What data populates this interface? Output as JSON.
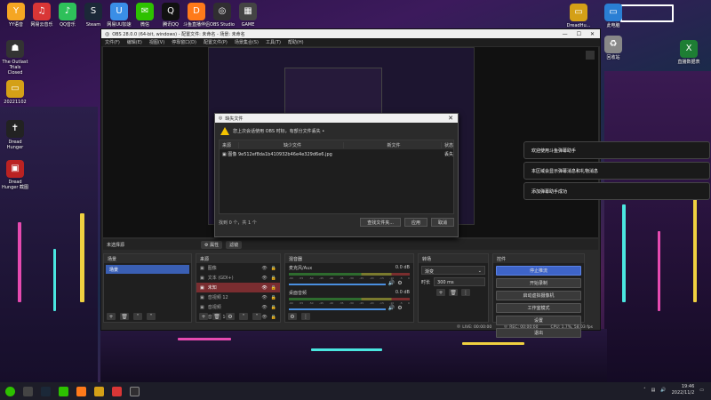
{
  "desktop": {
    "icons_top": [
      {
        "label": "YY语音",
        "color": "#f5a623",
        "glyph": "Y"
      },
      {
        "label": "网易云音乐",
        "color": "#d93636",
        "glyph": "♫"
      },
      {
        "label": "QQ音乐",
        "color": "#2ec05a",
        "glyph": "♪"
      },
      {
        "label": "Steam",
        "color": "#1b2838",
        "glyph": "S"
      },
      {
        "label": "网易UU加速",
        "color": "#3a8ee6",
        "glyph": "U"
      },
      {
        "label": "微信",
        "color": "#2dc100",
        "glyph": "✉"
      },
      {
        "label": "腾讯QQ",
        "color": "#111",
        "glyph": "Q"
      },
      {
        "label": "斗鱼直播伴侣",
        "color": "#ff7a1a",
        "glyph": "D"
      },
      {
        "label": "OBS Studio",
        "color": "#302e31",
        "glyph": "◎"
      },
      {
        "label": "GAME",
        "color": "#444",
        "glyph": "▦"
      }
    ],
    "icons_left": [
      {
        "label": "The Outlast Trials Closed",
        "color": "#333",
        "glyph": "☗"
      },
      {
        "label": "20221102",
        "color": "#d4a017",
        "glyph": "▭"
      },
      {
        "label": "Dread Hunger",
        "color": "#222",
        "glyph": "✝"
      },
      {
        "label": "Dread Hunger 截图",
        "color": "#b22",
        "glyph": "▣"
      }
    ],
    "icons_right": [
      {
        "label": "DreadHu...",
        "color": "#d4a017",
        "glyph": "▭"
      },
      {
        "label": "此电脑",
        "color": "#2a7fd4",
        "glyph": "▭"
      },
      {
        "label": "回收站",
        "color": "#888",
        "glyph": "♻"
      },
      {
        "label": "直播数据表",
        "color": "#1e7e34",
        "glyph": "X"
      }
    ]
  },
  "obs": {
    "title": "OBS 28.0.0 (64-bit, windows) - 配置文件: 未命名 - 场景: 未命名",
    "menu": [
      "文件(F)",
      "编辑(E)",
      "视图(V)",
      "停靠窗口(D)",
      "配置文件(P)",
      "场景集合(S)",
      "工具(T)",
      "帮助(H)"
    ],
    "no_source": "未选择源",
    "properties_label": "属性",
    "filters_label": "滤镜",
    "scenes": {
      "header": "场景",
      "items": [
        "场景"
      ]
    },
    "sources": {
      "header": "来源",
      "items": [
        {
          "label": "图像",
          "selected": false
        },
        {
          "label": "文本 (GDI+)",
          "selected": false
        },
        {
          "label": "未知",
          "selected": true
        },
        {
          "label": "音视频 12",
          "selected": false
        },
        {
          "label": "音视频",
          "selected": false
        },
        {
          "label": "音视频 10",
          "selected": false
        }
      ]
    },
    "mixer": {
      "header": "混音器",
      "channels": [
        {
          "name": "麦克风/Aux",
          "db": "0.0 dB"
        },
        {
          "name": "桌面音频",
          "db": "0.0 dB"
        }
      ],
      "scale": [
        "-60",
        "-55",
        "-50",
        "-45",
        "-40",
        "-35",
        "-30",
        "-25",
        "-20",
        "-15",
        "-10",
        "-5",
        "0"
      ]
    },
    "transitions": {
      "header": "转场",
      "type": "渐变",
      "duration_label": "时长",
      "duration_value": "300 ms"
    },
    "controls": {
      "header": "控件",
      "buttons": [
        {
          "label": "停止推流",
          "active": true
        },
        {
          "label": "开始录制",
          "active": false
        },
        {
          "label": "启动虚拟摄像机",
          "active": false
        },
        {
          "label": "工作室模式",
          "active": false
        },
        {
          "label": "设置",
          "active": false
        },
        {
          "label": "退出",
          "active": false
        }
      ]
    },
    "status": {
      "live": "LIVE: 00:00:00",
      "rec": "REC: 00:00:00",
      "cpu": "CPU: 1.7%, 58.03 fps"
    }
  },
  "dialog": {
    "title": "缺失文件",
    "warning": "您上次会话使用 OBS 时标，有部分文件丢失 •",
    "columns": [
      "来源",
      "缺少文件",
      "新文件",
      "状态"
    ],
    "rows": [
      {
        "source": "图像",
        "missing": "9e512ef8da1b410932b46e4e329d6e6.jpg",
        "new": "",
        "status": "丢失"
      }
    ],
    "found_text": "找到 0 个，共 1 个",
    "search_button": "查找文件夹...",
    "apply_button": "应用",
    "cancel_button": "取消"
  },
  "notifications": [
    "欢迎使用斗鱼弹幕助手",
    "本区域会显示弹幕消息和礼物消息",
    "添加弹幕助手成功"
  ],
  "tray": {
    "time": "19:46",
    "date": "2022/11/2"
  }
}
